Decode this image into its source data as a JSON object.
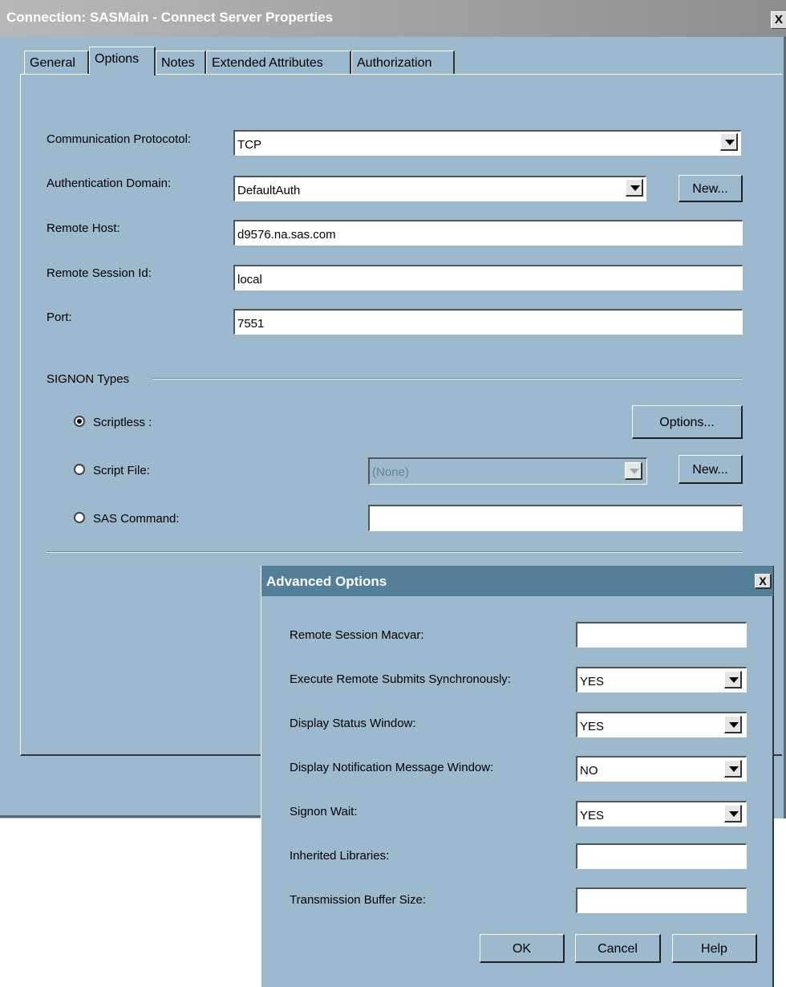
{
  "window": {
    "title": "Connection: SASMain - Connect Server Properties",
    "close_glyph": "X"
  },
  "tabs": [
    {
      "label": "General",
      "active": false
    },
    {
      "label": "Options",
      "active": true
    },
    {
      "label": "Notes",
      "active": false
    },
    {
      "label": "Extended Attributes",
      "active": false
    },
    {
      "label": "Authorization",
      "active": false
    }
  ],
  "form": {
    "protocol_label": "Communication Protocotol:",
    "protocol_value": "TCP",
    "auth_domain_label": "Authentication Domain:",
    "auth_domain_value": "DefaultAuth",
    "new_label": "New...",
    "remote_host_label": "Remote Host:",
    "remote_host_value": "d9576.na.sas.com",
    "session_id_label": "Remote Session Id:",
    "session_id_value": "local",
    "port_label": "Port:",
    "port_value": "7551"
  },
  "signon": {
    "group_label": "SIGNON Types",
    "scriptless_label": "Scriptless :",
    "scriptless_selected": true,
    "options_button": "Options...",
    "script_file_label": "Script File:",
    "script_file_value": "(None)",
    "script_new_button": "New...",
    "sas_command_label": "SAS Command:",
    "sas_command_value": ""
  },
  "advanced_dialog": {
    "title": "Advanced Options",
    "close_glyph": "X",
    "macvar_label": "Remote Session Macvar:",
    "macvar_value": "",
    "sync_label": "Execute Remote Submits Synchronously:",
    "sync_value": "YES",
    "status_label": "Display Status Window:",
    "status_value": "YES",
    "notify_label": "Display Notification Message Window:",
    "notify_value": "NO",
    "wait_label": "Signon Wait:",
    "wait_value": "YES",
    "libraries_label": "Inherited Libraries:",
    "libraries_value": "",
    "buffer_label": "Transmission Buffer Size:",
    "buffer_value": "",
    "ok_button": "OK",
    "cancel_button": "Cancel",
    "help_button": "Help"
  },
  "colors": {
    "background": "#9db9ce",
    "dialog_title": "#537f98",
    "title_bar": "#a8a8a8"
  }
}
